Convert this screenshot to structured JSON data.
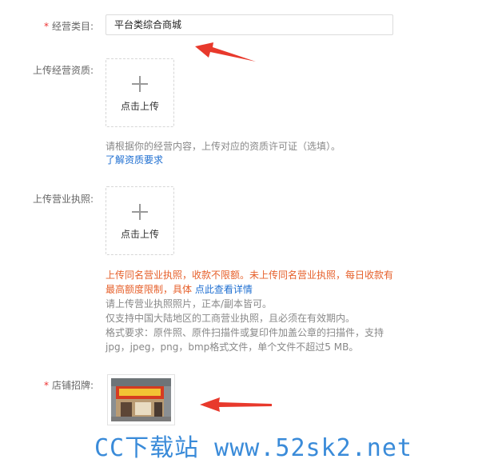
{
  "category": {
    "label": "经营类目:",
    "value": "平台类综合商城"
  },
  "qualification": {
    "label": "上传经营资质:",
    "upload_text": "点击上传",
    "hint": "请根据你的经营内容，上传对应的资质许可证（选填）。",
    "link": "了解资质要求"
  },
  "license": {
    "label": "上传营业执照:",
    "upload_text": "点击上传",
    "warning_1": "上传同名营业执照，收款不限额。未上传同名营业执照，每日收款有",
    "warning_2": "最高额度限制，具体 ",
    "warning_link": "点此查看详情",
    "line_1": "请上传营业执照照片，正本/副本皆可。",
    "line_2": "仅支持中国大陆地区的工商营业执照，且必须在有效期内。",
    "line_3": "格式要求：原件照、原件扫描件或复印件加盖公章的扫描件，支持",
    "line_4": "jpg，jpeg，png，bmp格式文件，单个文件不超过5 MB。"
  },
  "signboard": {
    "label": "店铺招牌:"
  },
  "watermark": "CC下载站 www.52sk2.net",
  "colors": {
    "required": "#ee3333",
    "warning": "#e6602b",
    "link": "#1f6fd1",
    "arrow": "#e8392c",
    "watermark": "#3a8bd9"
  }
}
